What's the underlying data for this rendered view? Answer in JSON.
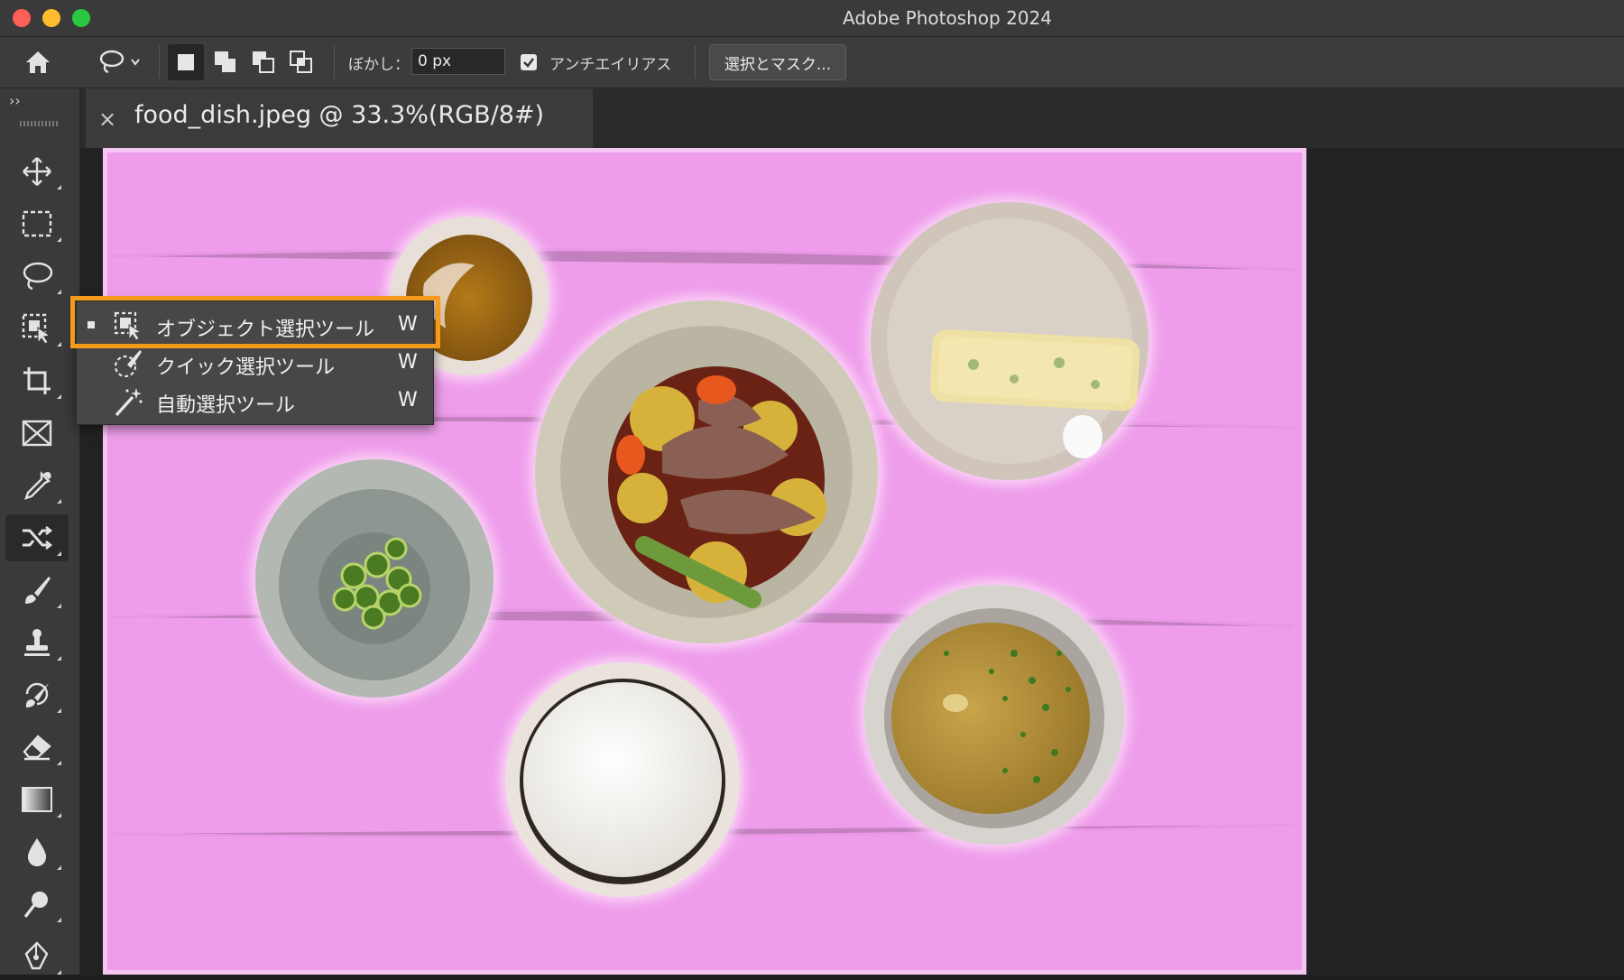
{
  "window": {
    "title": "Adobe Photoshop 2024"
  },
  "options_bar": {
    "feather_label": "ぼかし：",
    "feather_value": "0 px",
    "antialias_label": "アンチエイリアス",
    "antialias_checked": true,
    "select_mask_label": "選択とマスク..."
  },
  "toolbar": {
    "collapse": "››"
  },
  "document": {
    "tab_close": "×",
    "tab_title": "food_dish.jpeg @ 33.3%(RGB/8#)"
  },
  "flyout": {
    "items": [
      {
        "label": "オブジェクト選択ツール",
        "shortcut": "W",
        "icon": "object-selection-icon",
        "selected": true
      },
      {
        "label": "クイック選択ツール",
        "shortcut": "W",
        "icon": "quick-selection-icon",
        "selected": false
      },
      {
        "label": "自動選択ツール",
        "shortcut": "W",
        "icon": "magic-wand-icon",
        "selected": false
      }
    ]
  },
  "colors": {
    "highlight": "#f49a1c",
    "selection_overlay": "#ee9dea",
    "chrome": "#3a3a3a"
  }
}
